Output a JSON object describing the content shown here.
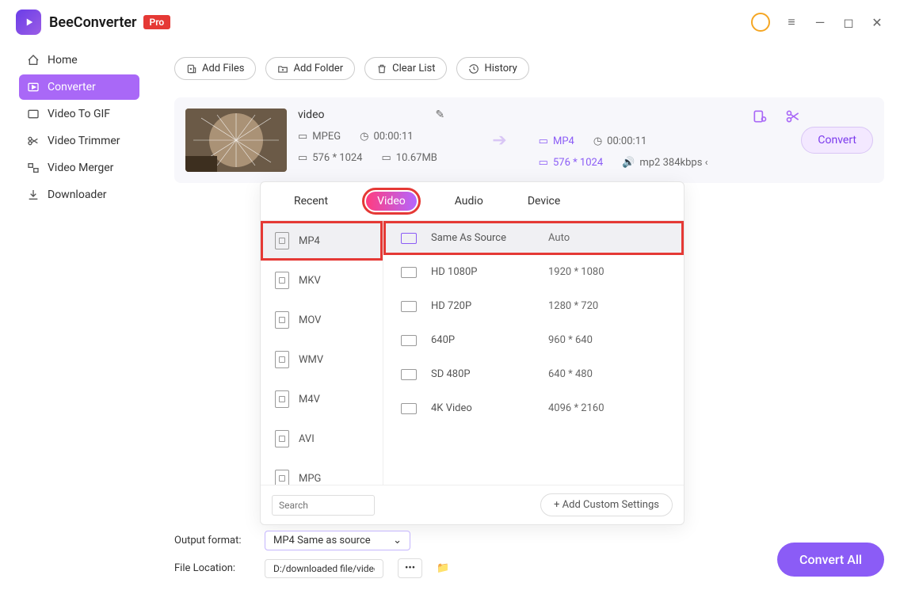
{
  "app": {
    "name": "BeeConverter",
    "badge": "Pro"
  },
  "sidebar": {
    "items": [
      {
        "label": "Home"
      },
      {
        "label": "Converter"
      },
      {
        "label": "Video To GIF"
      },
      {
        "label": "Video Trimmer"
      },
      {
        "label": "Video Merger"
      },
      {
        "label": "Downloader"
      }
    ]
  },
  "toolbar": {
    "add_files": "Add Files",
    "add_folder": "Add Folder",
    "clear_list": "Clear List",
    "history": "History"
  },
  "video": {
    "name": "video",
    "src_format": "MPEG",
    "src_duration": "00:00:11",
    "src_dims": "576 * 1024",
    "src_size": "10.67MB",
    "out_format": "MP4",
    "out_duration": "00:00:11",
    "out_dims": "576 * 1024",
    "out_audio": "mp2 384kbps ‹",
    "convert_label": "Convert"
  },
  "popup": {
    "tabs": [
      "Recent",
      "Video",
      "Audio",
      "Device"
    ],
    "formats": [
      "MP4",
      "MKV",
      "MOV",
      "WMV",
      "M4V",
      "AVI",
      "MPG"
    ],
    "resolutions": [
      {
        "name": "Same As Source",
        "dim": "Auto"
      },
      {
        "name": "HD 1080P",
        "dim": "1920 * 1080"
      },
      {
        "name": "HD 720P",
        "dim": "1280 * 720"
      },
      {
        "name": "640P",
        "dim": "960 * 640"
      },
      {
        "name": "SD 480P",
        "dim": "640 * 480"
      },
      {
        "name": "4K Video",
        "dim": "4096 * 2160"
      }
    ],
    "search_placeholder": "Search",
    "add_custom": "+ Add Custom Settings"
  },
  "bottom": {
    "output_format_label": "Output format:",
    "output_format_value": "MP4 Same as source",
    "file_location_label": "File Location:",
    "file_location_value": "D:/downloaded file/video/",
    "convert_all": "Convert All"
  }
}
